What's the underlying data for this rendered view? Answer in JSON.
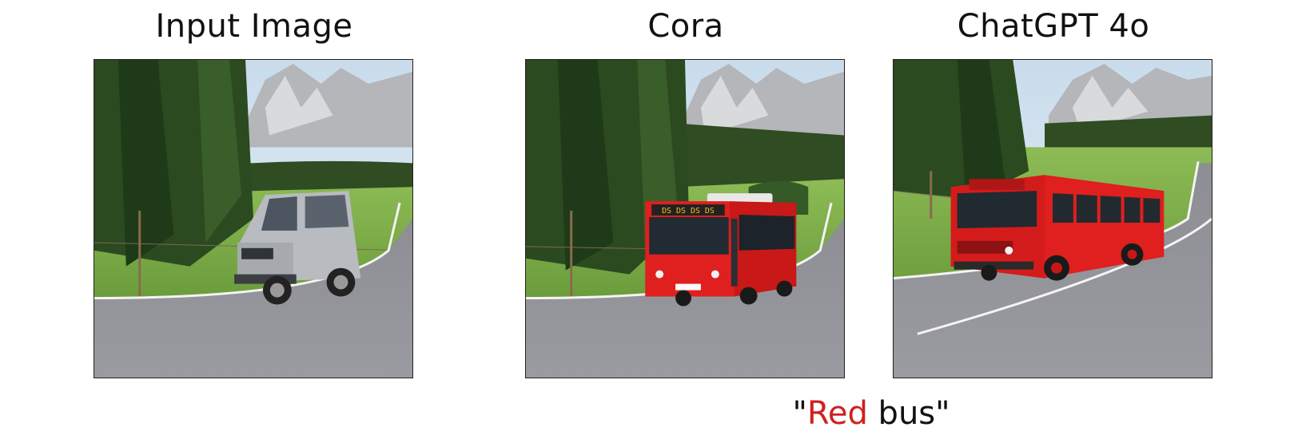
{
  "panels": [
    {
      "title": "Input Image",
      "vehicle": "silver-suv"
    },
    {
      "title": "Cora",
      "vehicle": "red-city-bus",
      "sign_text": "DS DS DS DS"
    },
    {
      "title": "ChatGPT 4o",
      "vehicle": "red-retro-bus"
    }
  ],
  "caption": {
    "open_quote": "\"",
    "highlight": "Red",
    "rest": " bus",
    "close_quote": "\""
  },
  "colors": {
    "highlight": "#d11f1f",
    "bus_red": "#e01f1f",
    "grass": "#7fb04a",
    "road": "#8f9096"
  }
}
